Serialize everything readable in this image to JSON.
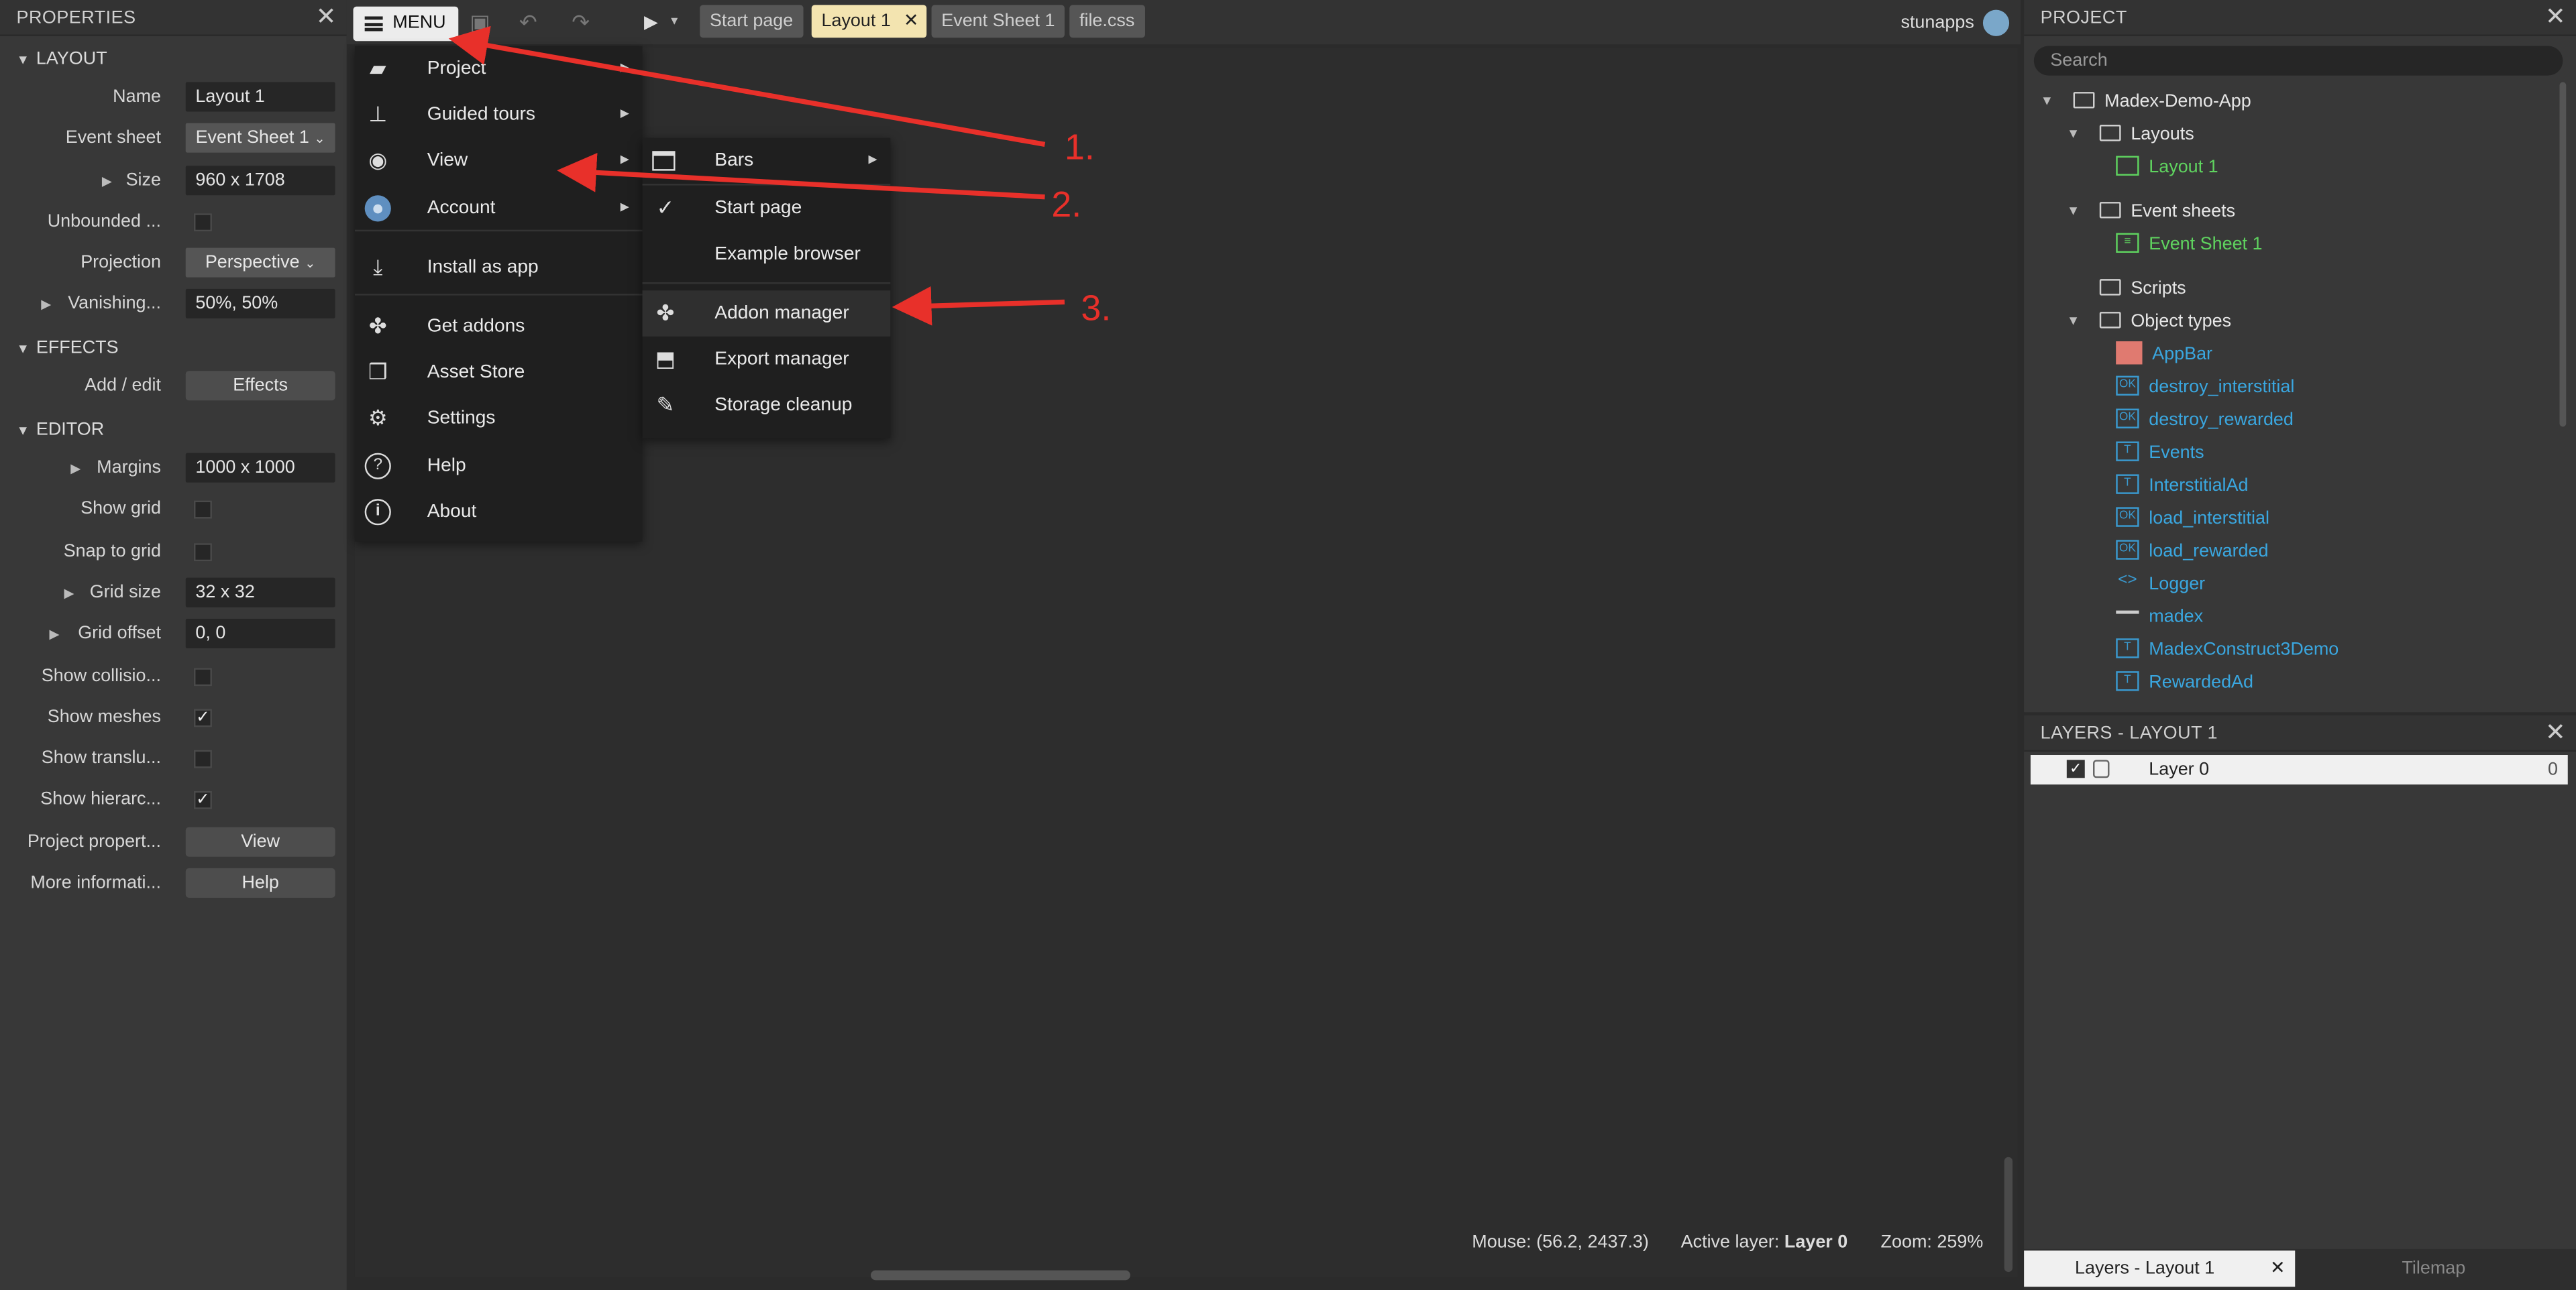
{
  "properties": {
    "title": "PROPERTIES",
    "sections": {
      "layout": "LAYOUT",
      "effects": "EFFECTS",
      "editor": "EDITOR"
    },
    "layout_rows": [
      {
        "label": "Name",
        "value": "Layout 1"
      },
      {
        "label": "Event sheet",
        "value": "Event Sheet 1"
      },
      {
        "label": "Size",
        "value": "960 x 1708"
      },
      {
        "label": "Unbounded ...",
        "checked": false
      },
      {
        "label": "Projection",
        "value": "Perspective"
      },
      {
        "label": "Vanishing...",
        "value": "50%, 50%"
      }
    ],
    "effects_row": {
      "label": "Add / edit",
      "button": "Effects"
    },
    "editor_rows": [
      {
        "label": "Margins",
        "value": "1000 x 1000"
      },
      {
        "label": "Show grid",
        "checked": false
      },
      {
        "label": "Snap to grid",
        "checked": false
      },
      {
        "label": "Grid size",
        "value": "32 x 32"
      },
      {
        "label": "Grid offset",
        "value": "0, 0"
      },
      {
        "label": "Show collisio...",
        "checked": false
      },
      {
        "label": "Show meshes",
        "checked": true
      },
      {
        "label": "Show translu...",
        "checked": false
      },
      {
        "label": "Show hierarc...",
        "checked": true
      },
      {
        "label": "Project propert...",
        "button": "View"
      },
      {
        "label": "More informati...",
        "button": "Help"
      }
    ]
  },
  "toolbar": {
    "menu_label": "MENU",
    "tabs": [
      "Start page",
      "Layout 1",
      "Event Sheet 1",
      "file.css"
    ],
    "user": "stunapps"
  },
  "main_menu": [
    {
      "label": "Project",
      "icon": "gamepad-icon",
      "submenu": true
    },
    {
      "label": "Guided tours",
      "icon": "signpost-icon",
      "submenu": true
    },
    {
      "label": "View",
      "icon": "eye-icon",
      "submenu": true
    },
    {
      "label": "Account",
      "icon": "avatar-icon",
      "submenu": true
    },
    {
      "label": "Install as app",
      "icon": "download-icon",
      "submenu": false
    },
    {
      "label": "Get addons",
      "icon": "puzzle-icon",
      "submenu": false
    },
    {
      "label": "Asset Store",
      "icon": "boxes-icon",
      "submenu": false
    },
    {
      "label": "Settings",
      "icon": "gear-icon",
      "submenu": false
    },
    {
      "label": "Help",
      "icon": "question-icon",
      "submenu": false
    },
    {
      "label": "About",
      "icon": "info-icon",
      "submenu": false
    }
  ],
  "view_menu": [
    {
      "label": "Bars",
      "icon": "window-icon",
      "submenu": true
    },
    {
      "label": "Start page",
      "icon": "check-icon",
      "submenu": false
    },
    {
      "label": "Example browser",
      "icon": "",
      "submenu": false
    },
    {
      "label": "Addon manager",
      "icon": "puzzle-icon",
      "submenu": false
    },
    {
      "label": "Export manager",
      "icon": "export-icon",
      "submenu": false
    },
    {
      "label": "Storage cleanup",
      "icon": "broom-icon",
      "submenu": false
    }
  ],
  "status": {
    "mouse": "Mouse: (56.2, 2437.3)",
    "active_layer_label": "Active layer:",
    "active_layer": "Layer 0",
    "zoom": "Zoom: 259%"
  },
  "project": {
    "title": "PROJECT",
    "search_placeholder": "Search",
    "root": "Madex-Demo-App",
    "folders": {
      "layouts": "Layouts",
      "layout_item": "Layout 1",
      "event_sheets": "Event sheets",
      "event_item": "Event Sheet 1",
      "scripts": "Scripts",
      "object_types": "Object types"
    },
    "objects": [
      "AppBar",
      "destroy_interstitial",
      "destroy_rewarded",
      "Events",
      "InterstitialAd",
      "load_interstitial",
      "load_rewarded",
      "Logger",
      "madex",
      "MadexConstruct3Demo",
      "RewardedAd"
    ]
  },
  "layers": {
    "title": "LAYERS - LAYOUT 1",
    "layer_name": "Layer 0",
    "layer_index": "0",
    "tab_active": "Layers - Layout 1",
    "tab_other": "Tilemap"
  },
  "annotations": [
    "1.",
    "2.",
    "3."
  ],
  "colors": {
    "accent_green": "#5fd35f",
    "object_blue": "#3aa7e0",
    "arrow_red": "#e8302a",
    "active_tab": "#f3e4b0"
  }
}
